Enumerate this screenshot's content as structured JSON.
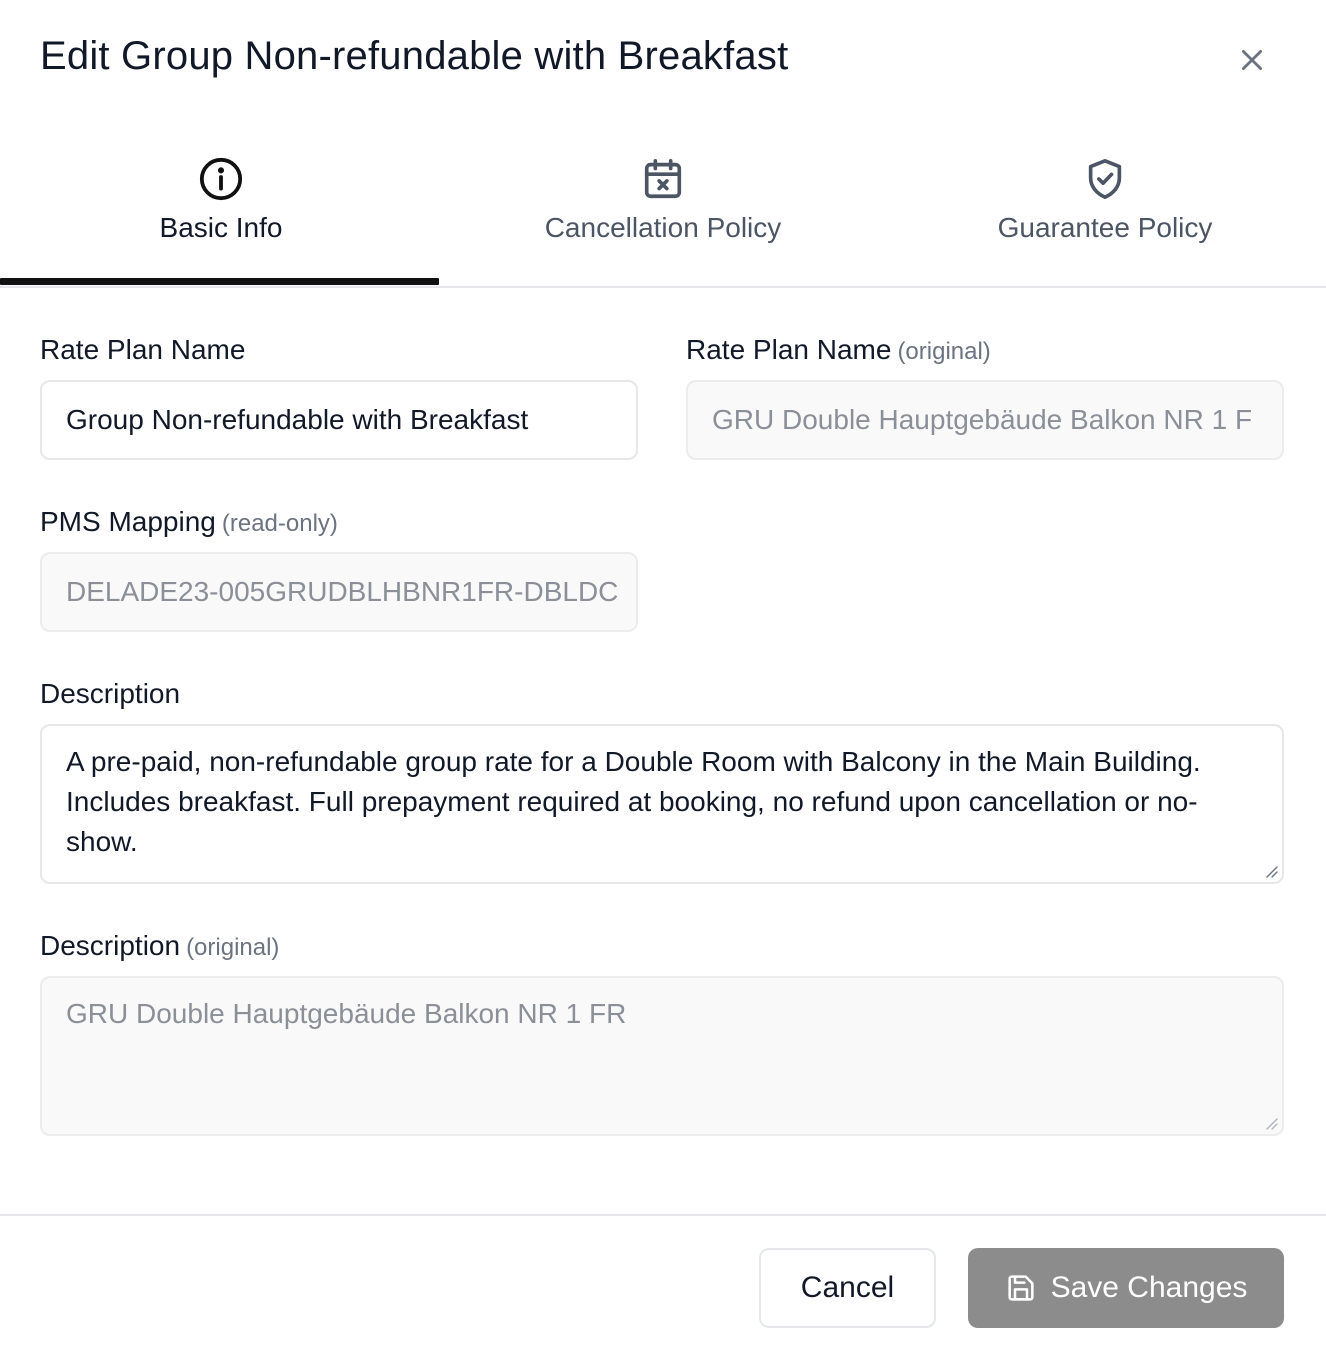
{
  "dialog": {
    "title": "Edit Group Non-refundable with Breakfast",
    "close_icon": "close-icon"
  },
  "tabs": [
    {
      "label": "Basic Info",
      "icon": "info-circle-icon",
      "active": true
    },
    {
      "label": "Cancellation Policy",
      "icon": "calendar-x-icon",
      "active": false
    },
    {
      "label": "Guarantee Policy",
      "icon": "shield-check-icon",
      "active": false
    }
  ],
  "form": {
    "rate_plan_name": {
      "label": "Rate Plan Name",
      "value": "Group Non-refundable with Breakfast"
    },
    "rate_plan_name_original": {
      "label": "Rate Plan Name",
      "sublabel": "(original)",
      "value": "GRU Double Hauptgebäude Balkon NR 1 F"
    },
    "pms_mapping": {
      "label": "PMS Mapping",
      "sublabel": "(read-only)",
      "value": "DELADE23-005GRUDBLHBNR1FR-DBLDC"
    },
    "description": {
      "label": "Description",
      "value": "A pre-paid, non-refundable group rate for a Double Room with Balcony in the Main Building. Includes breakfast. Full prepayment required at booking, no refund upon cancellation or no-show."
    },
    "description_original": {
      "label": "Description",
      "sublabel": "(original)",
      "value": "GRU Double Hauptgebäude Balkon NR 1 FR"
    }
  },
  "footer": {
    "cancel_label": "Cancel",
    "save_label": "Save Changes",
    "save_icon": "save-icon"
  },
  "colors": {
    "active_tab_indicator": "#111111",
    "save_button_bg": "#8c8c8c",
    "readonly_bg": "#f9f9f9",
    "border": "#e5e7eb"
  }
}
